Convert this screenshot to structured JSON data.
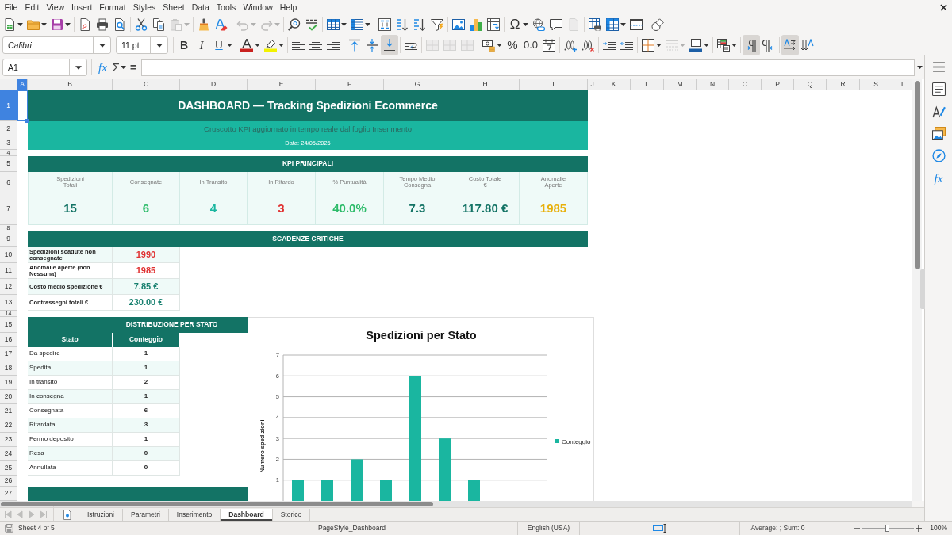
{
  "menu_bar": {
    "items": [
      "File",
      "Edit",
      "View",
      "Insert",
      "Format",
      "Styles",
      "Sheet",
      "Data",
      "Tools",
      "Window",
      "Help"
    ]
  },
  "standard_toolbar": [
    [
      {
        "dropdown": true,
        "disabled": false
      },
      {
        "dropdown": true,
        "disabled": false
      },
      {
        "dropdown": true,
        "disabled": false
      }
    ],
    [
      {
        "dropdown": false,
        "disabled": false
      },
      {
        "dropdown": false,
        "disabled": false
      },
      {
        "dropdown": false,
        "disabled": false
      }
    ],
    [
      {
        "dropdown": false,
        "disabled": false
      },
      {
        "dropdown": false,
        "disabled": false
      },
      {
        "dropdown": true,
        "disabled": true
      }
    ],
    [
      {
        "dropdown": false,
        "disabled": false
      },
      {
        "dropdown": false,
        "disabled": false
      }
    ],
    [
      {
        "dropdown": true,
        "disabled": true
      },
      {
        "dropdown": true,
        "disabled": true
      }
    ],
    [
      {
        "dropdown": false,
        "disabled": false
      },
      {
        "dropdown": false,
        "disabled": false
      }
    ],
    [
      {
        "dropdown": true,
        "disabled": false
      },
      {
        "dropdown": true,
        "disabled": false
      }
    ],
    [
      {
        "dropdown": false,
        "disabled": false
      },
      {
        "dropdown": false,
        "disabled": false
      },
      {
        "dropdown": false,
        "disabled": false
      },
      {
        "dropdown": false,
        "disabled": false
      }
    ],
    [
      {
        "dropdown": false,
        "disabled": false
      },
      {
        "dropdown": false,
        "disabled": false
      },
      {
        "dropdown": false,
        "disabled": false
      }
    ],
    [
      {
        "glyph": "Ω",
        "dropdown": true,
        "disabled": false
      },
      {
        "dropdown": false,
        "disabled": false
      },
      {
        "dropdown": false,
        "disabled": false
      },
      {
        "dropdown": false,
        "disabled": true
      }
    ],
    [
      {
        "dropdown": false,
        "disabled": false
      },
      {
        "dropdown": true,
        "disabled": false
      },
      {
        "dropdown": false,
        "disabled": false
      }
    ],
    [
      {
        "dropdown": false,
        "disabled": false
      }
    ]
  ],
  "formatting_toolbar": {
    "font_name": "Calibri",
    "font_size": "11 pt",
    "groups": [
      [
        {
          "glyph": "B",
          "dropdown": false,
          "disabled": false,
          "on": false
        },
        {
          "glyph": "I",
          "dropdown": false,
          "disabled": false,
          "on": false
        },
        {
          "glyph": "U",
          "dropdown": true,
          "disabled": false,
          "on": false
        }
      ],
      [
        {
          "dropdown": true,
          "disabled": false,
          "on": false
        },
        {
          "dropdown": true,
          "disabled": false,
          "on": false
        }
      ],
      [
        {
          "dropdown": false,
          "disabled": false,
          "on": false
        },
        {
          "dropdown": false,
          "disabled": false,
          "on": false
        },
        {
          "dropdown": false,
          "disabled": false,
          "on": false
        }
      ],
      [
        {
          "dropdown": false,
          "disabled": false,
          "on": false
        },
        {
          "dropdown": false,
          "disabled": false,
          "on": false
        },
        {
          "dropdown": false,
          "disabled": false,
          "on": true
        }
      ],
      [
        {
          "dropdown": false,
          "disabled": false,
          "on": false
        }
      ],
      [
        {
          "dropdown": false,
          "disabled": true,
          "on": false
        },
        {
          "dropdown": false,
          "disabled": true,
          "on": false
        },
        {
          "dropdown": false,
          "disabled": true,
          "on": false
        }
      ],
      [
        {
          "dropdown": true,
          "disabled": false,
          "on": false
        },
        {
          "glyph": "%",
          "dropdown": false,
          "disabled": false,
          "on": false
        },
        {
          "glyph": "0.0",
          "dropdown": false,
          "disabled": false,
          "on": false
        },
        {
          "dropdown": false,
          "disabled": false,
          "on": false
        }
      ],
      [
        {
          "dropdown": false,
          "disabled": false,
          "on": false
        },
        {
          "dropdown": false,
          "disabled": false,
          "on": false
        }
      ],
      [
        {
          "dropdown": false,
          "disabled": false,
          "on": false
        },
        {
          "dropdown": false,
          "disabled": false,
          "on": false
        }
      ],
      [
        {
          "dropdown": true,
          "disabled": false,
          "on": false
        },
        {
          "dropdown": true,
          "disabled": true,
          "on": false
        },
        {
          "dropdown": true,
          "disabled": false,
          "on": false
        }
      ],
      [
        {
          "dropdown": true,
          "disabled": false,
          "on": false
        }
      ],
      [
        {
          "dropdown": false,
          "disabled": false,
          "on": true
        },
        {
          "dropdown": false,
          "disabled": false,
          "on": false
        }
      ],
      [
        {
          "dropdown": false,
          "disabled": false,
          "on": true
        },
        {
          "dropdown": false,
          "disabled": false,
          "on": false
        }
      ]
    ]
  },
  "formula_bar": {
    "name_box": "A1",
    "function_wizard": "fx",
    "sum": "Σ",
    "formula": "="
  },
  "sidebar": {
    "functions_button": "fx"
  },
  "sheet": {
    "column_headers": [
      {
        "label": "A",
        "selected": true
      },
      {
        "label": "B",
        "selected": false
      },
      {
        "label": "C",
        "selected": false
      },
      {
        "label": "D",
        "selected": false
      },
      {
        "label": "E",
        "selected": false
      },
      {
        "label": "F",
        "selected": false
      },
      {
        "label": "G",
        "selected": false
      },
      {
        "label": "H",
        "selected": false
      },
      {
        "label": "I",
        "selected": false
      },
      {
        "label": "J",
        "selected": false
      },
      {
        "label": "K",
        "selected": false
      },
      {
        "label": "L",
        "selected": false
      },
      {
        "label": "M",
        "selected": false
      },
      {
        "label": "N",
        "selected": false
      },
      {
        "label": "O",
        "selected": false
      },
      {
        "label": "P",
        "selected": false
      },
      {
        "label": "Q",
        "selected": false
      },
      {
        "label": "R",
        "selected": false
      },
      {
        "label": "S",
        "selected": false
      },
      {
        "label": "T",
        "selected": false
      }
    ],
    "row_headers": [
      {
        "label": "1",
        "selected": true
      },
      {
        "label": "2",
        "selected": false
      },
      {
        "label": "3",
        "selected": false
      },
      {
        "label": "4",
        "selected": false
      },
      {
        "label": "5",
        "selected": false
      },
      {
        "label": "6",
        "selected": false
      },
      {
        "label": "7",
        "selected": false
      },
      {
        "label": "8",
        "selected": false
      },
      {
        "label": "9",
        "selected": false
      },
      {
        "label": "10",
        "selected": false
      },
      {
        "label": "11",
        "selected": false
      },
      {
        "label": "12",
        "selected": false
      },
      {
        "label": "13",
        "selected": false
      },
      {
        "label": "14",
        "selected": false
      },
      {
        "label": "15",
        "selected": false
      },
      {
        "label": "16",
        "selected": false
      },
      {
        "label": "17",
        "selected": false
      },
      {
        "label": "18",
        "selected": false
      },
      {
        "label": "19",
        "selected": false
      },
      {
        "label": "20",
        "selected": false
      },
      {
        "label": "21",
        "selected": false
      },
      {
        "label": "22",
        "selected": false
      },
      {
        "label": "23",
        "selected": false
      },
      {
        "label": "24",
        "selected": false
      },
      {
        "label": "25",
        "selected": false
      },
      {
        "label": "26",
        "selected": false
      },
      {
        "label": "27",
        "selected": false
      }
    ],
    "title": "DASHBOARD — Tracking Spedizioni Ecommerce",
    "subtitle": "Cruscotto KPI aggiornato in tempo reale dal foglio Inserimento",
    "date": "Data: 24/05/2026",
    "kpi": {
      "header": "KPI PRINCIPALI",
      "items": [
        {
          "label": "Spedizioni\nTotali",
          "value": "15",
          "color": "#137365"
        },
        {
          "label": "Consegnate",
          "value": "6",
          "color": "#2dbb6a"
        },
        {
          "label": "In Transito",
          "value": "4",
          "color": "#1ab6a0"
        },
        {
          "label": "In Ritardo",
          "value": "3",
          "color": "#e03131"
        },
        {
          "label": "% Puntualità",
          "value": "40.0%",
          "color": "#2dbb6a"
        },
        {
          "label": "Tempo Medio\nConsegna",
          "value": "7.3",
          "color": "#137365"
        },
        {
          "label": "Costo Totale\n€",
          "value": "117.80 €",
          "color": "#137365"
        },
        {
          "label": "Anomalie\nAperte",
          "value": "1985",
          "color": "#e8b00c"
        }
      ]
    },
    "deadlines": {
      "header": "SCADENZE CRITICHE",
      "items": [
        {
          "label": "Spedizioni scadute non consegnate",
          "value": "1990",
          "color": "#e03131"
        },
        {
          "label": "Anomalie aperte (non Nessuna)",
          "value": "1985",
          "color": "#e03131"
        },
        {
          "label": "Costo medio spedizione €",
          "value": "7.85 €",
          "color": "#17806f"
        },
        {
          "label": "Contrassegni totali €",
          "value": "230.00 €",
          "color": "#17806f"
        }
      ]
    },
    "distribution": {
      "header": "DISTRIBUZIONE PER STATO",
      "columns": [
        "Stato",
        "Conteggio"
      ],
      "rows": [
        [
          "Da spedire",
          "1"
        ],
        [
          "Spedita",
          "1"
        ],
        [
          "In transito",
          "2"
        ],
        [
          "In consegna",
          "1"
        ],
        [
          "Consegnata",
          "6"
        ],
        [
          "Ritardata",
          "3"
        ],
        [
          "Fermo deposito",
          "1"
        ],
        [
          "Resa",
          "0"
        ],
        [
          "Annullata",
          "0"
        ]
      ]
    },
    "chart": {
      "chart_data": {
        "type": "bar",
        "title": "Spedizioni per Stato",
        "ylabel": "Numero spedizioni",
        "series": [
          {
            "name": "Conteggio",
            "color": "#1ab6a0",
            "values": [
              1,
              1,
              2,
              1,
              6,
              3,
              1,
              0,
              0
            ]
          }
        ],
        "ylim": [
          0,
          7
        ],
        "yticks": [
          1,
          2,
          3,
          4,
          5,
          6,
          7
        ],
        "grid": true
      }
    }
  },
  "sheet_tabs": {
    "navigation": [
      {
        "disabled": true
      },
      {
        "disabled": true
      },
      {
        "disabled": true
      },
      {
        "disabled": true
      }
    ],
    "tabs": [
      {
        "label": "Istruzioni",
        "selected": false
      },
      {
        "label": "Parametri",
        "selected": false
      },
      {
        "label": "Inserimento",
        "selected": false
      },
      {
        "label": "Dashboard",
        "selected": true
      },
      {
        "label": "Storico",
        "selected": false
      }
    ]
  },
  "status_bar": {
    "sheet_position": "Sheet 4 of 5",
    "page_style": "PageStyle_Dashboard",
    "language": "English (USA)",
    "selection_summary": "Average: ; Sum: 0",
    "zoom": {
      "level": 0.48,
      "reading": "100%"
    }
  }
}
